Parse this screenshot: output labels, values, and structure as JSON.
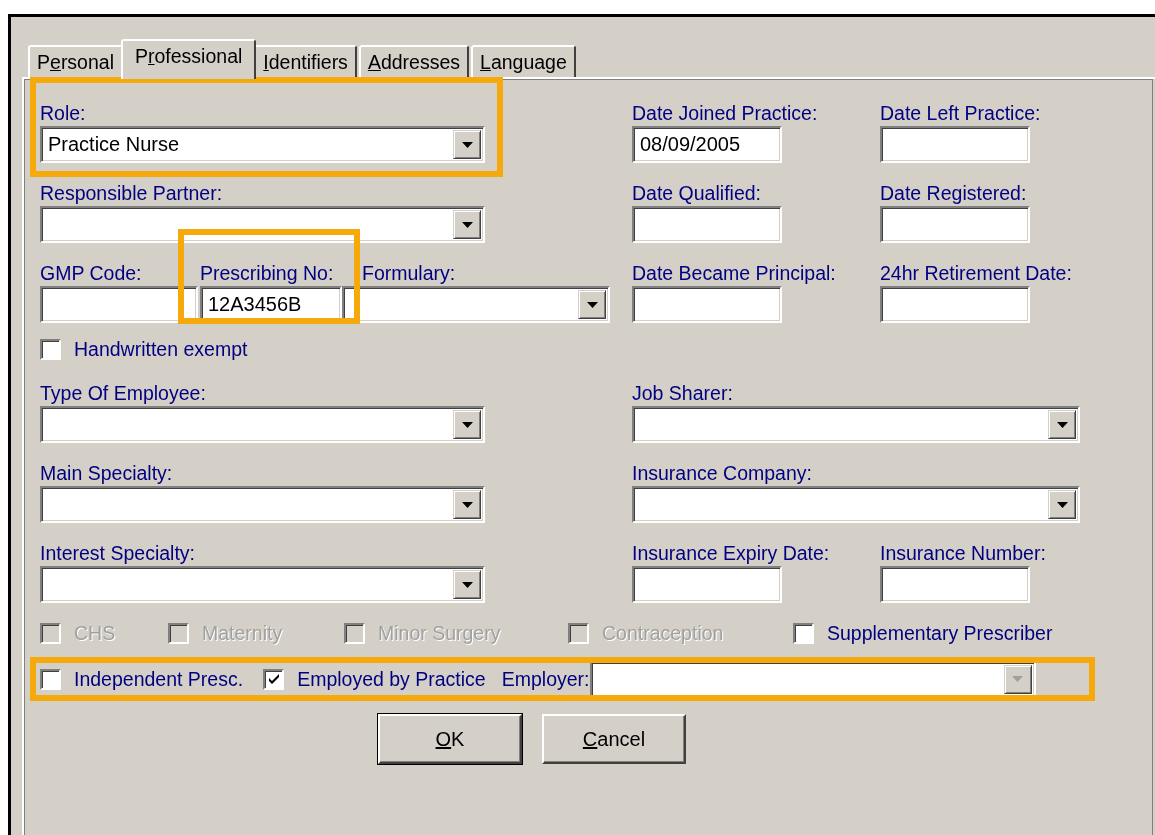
{
  "tabs": [
    {
      "pre": "P",
      "key": "e",
      "post": "rsonal",
      "selected": false
    },
    {
      "pre": "P",
      "key": "r",
      "post": "ofessional",
      "selected": true
    },
    {
      "key": "I",
      "post": "dentifiers",
      "selected": false
    },
    {
      "key": "A",
      "post": "ddresses",
      "selected": false
    },
    {
      "key": "L",
      "post": "anguage",
      "selected": false
    }
  ],
  "role": {
    "label": "Role:",
    "value": "Practice Nurse",
    "kind": "combo",
    "highlighted": true
  },
  "responsible_partner": {
    "label": "Responsible Partner:",
    "kind": "combo"
  },
  "gmp_code": {
    "label": "GMP Code:",
    "kind": "text"
  },
  "prescribing_no": {
    "label": "Prescribing No:",
    "value": "12A3456B",
    "kind": "text",
    "highlighted": true
  },
  "formulary": {
    "label": "Formulary:",
    "kind": "combo"
  },
  "handwritten_exempt": {
    "label": "Handwritten exempt",
    "checked": false,
    "disabled": false
  },
  "type_of_employee": {
    "label": "Type Of Employee:",
    "kind": "combo"
  },
  "main_specialty": {
    "label": "Main Specialty:",
    "kind": "combo"
  },
  "interest_specialty": {
    "label": "Interest Specialty:",
    "kind": "combo"
  },
  "date_joined_practice": {
    "label": "Date Joined Practice:",
    "value": "08/09/2005",
    "kind": "text"
  },
  "date_left_practice": {
    "label": "Date Left Practice:",
    "kind": "text"
  },
  "date_qualified": {
    "label": "Date Qualified:",
    "kind": "text"
  },
  "date_registered": {
    "label": "Date Registered:",
    "kind": "text"
  },
  "date_became_principal": {
    "label": "Date Became Principal:",
    "kind": "text"
  },
  "retirement_date_24hr": {
    "label": "24hr Retirement Date:",
    "kind": "text"
  },
  "job_sharer": {
    "label": "Job Sharer:",
    "kind": "combo"
  },
  "insurance_company": {
    "label": "Insurance Company:",
    "kind": "combo"
  },
  "insurance_expiry_date": {
    "label": "Insurance Expiry Date:",
    "kind": "text"
  },
  "insurance_number": {
    "label": "Insurance Number:",
    "kind": "text"
  },
  "options": [
    {
      "label": "CHS",
      "checked": false,
      "disabled": true
    },
    {
      "label": "Maternity",
      "checked": false,
      "disabled": true
    },
    {
      "label": "Minor Surgery",
      "checked": false,
      "disabled": true
    },
    {
      "label": "Contraception",
      "checked": false,
      "disabled": true
    },
    {
      "label": "Supplementary Prescriber",
      "checked": false,
      "disabled": false
    }
  ],
  "employment": {
    "highlighted": true,
    "independent_presc": {
      "label": "Independent Presc.",
      "checked": false,
      "disabled": false
    },
    "employed_by_practice": {
      "label": "Employed by Practice",
      "checked": true,
      "disabled": false
    },
    "employer": {
      "label": "Employer:",
      "kind": "combo",
      "disabled": true
    }
  },
  "buttons": [
    {
      "key": "O",
      "post": "K",
      "default": true
    },
    {
      "key": "C",
      "post": "ancel",
      "default": false
    }
  ]
}
